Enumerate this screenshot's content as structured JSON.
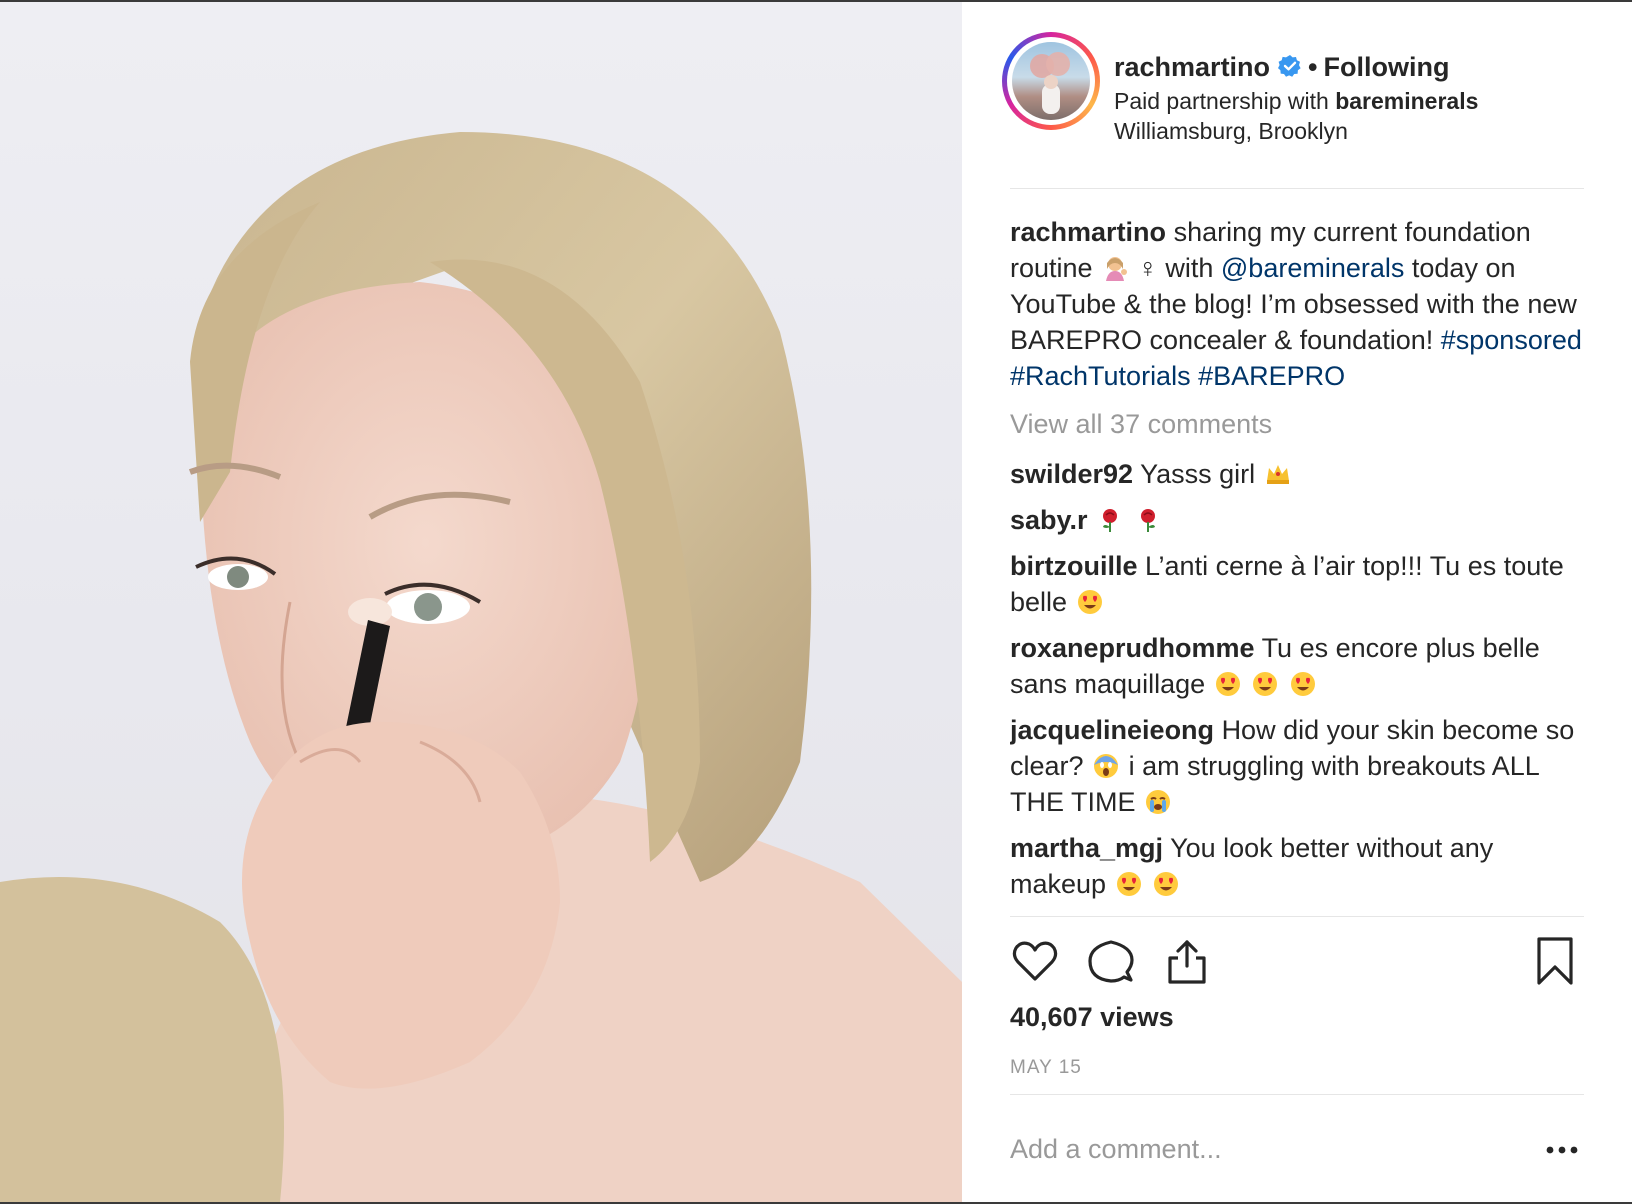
{
  "post": {
    "username": "rachmartino",
    "separator_dot": "•",
    "follow_status": "Following",
    "partnership_prefix": "Paid partnership with",
    "partner": "bareminerals",
    "location": "Williamsburg, Brooklyn",
    "caption": {
      "author": "rachmartino",
      "text_part1": "sharing my current foundation routine",
      "female_sign": "♀",
      "text_part2": "with",
      "mention": "@bareminerals",
      "text_part3": "today on YouTube & the blog! I’m obsessed with the new BAREPRO concealer & foundation!",
      "hashtags": [
        "#sponsored",
        "#RachTutorials",
        "#BAREPRO"
      ]
    },
    "view_all_comments": "View all 37 comments",
    "comments": [
      {
        "author": "swilder92",
        "text": "Yasss girl",
        "emojis": [
          "crown-emoji"
        ]
      },
      {
        "author": "saby.r",
        "text": "",
        "emojis": [
          "rose-emoji",
          "rose-emoji"
        ]
      },
      {
        "author": "birtzouille",
        "text": "L’anti cerne à l’air top!!! Tu es toute belle",
        "emojis": [
          "heart-eyes-emoji"
        ]
      },
      {
        "author": "roxaneprudhomme",
        "text": "Tu es encore plus belle sans maquillage",
        "emojis": [
          "heart-eyes-emoji",
          "heart-eyes-emoji",
          "heart-eyes-emoji"
        ]
      },
      {
        "author": "jacquelineieong",
        "text_part1": "How did your skin become so clear?",
        "text_part2": "i am struggling with breakouts ALL THE TIME",
        "emojis": [
          "screaming-emoji",
          "crying-emoji"
        ]
      },
      {
        "author": "martha_mgj",
        "text": "You look better without any makeup",
        "emojis": [
          "heart-eyes-emoji",
          "heart-eyes-emoji"
        ]
      }
    ],
    "views": "40,607 views",
    "date": "MAY 15",
    "add_comment_placeholder": "Add a comment...",
    "more_options": "•••"
  },
  "colors": {
    "text": "#262626",
    "link": "#003569",
    "muted": "#999999",
    "verified": "#3897f0",
    "divider": "#e6e6e6"
  }
}
